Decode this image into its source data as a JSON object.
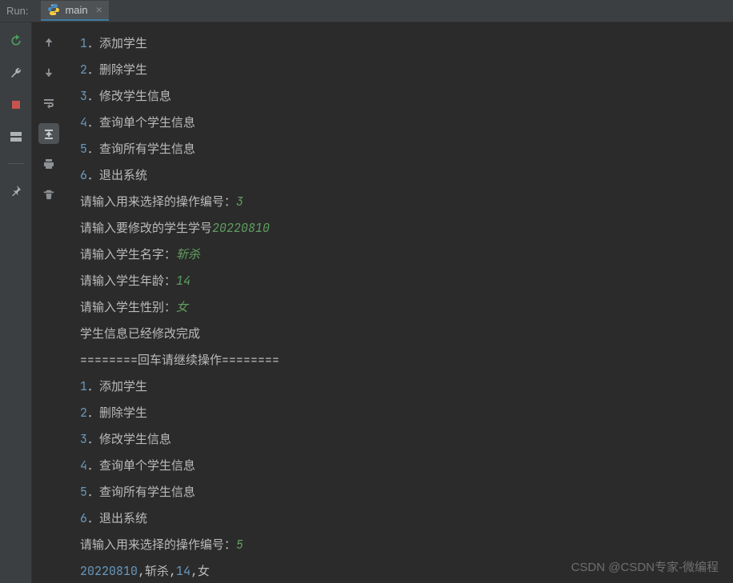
{
  "header": {
    "run_label": "Run:",
    "tab_name": "main",
    "close_char": "×"
  },
  "menu": {
    "m1": "添加学生",
    "m2": "删除学生",
    "m3": "修改学生信息",
    "m4": "查询单个学生信息",
    "m5": "查询所有学生信息",
    "m6": "退出系统"
  },
  "prompts": {
    "choose_op": "请输入用来选择的操作编号：",
    "choose_op_val1": "3",
    "enter_id": "请输入要修改的学生学号",
    "enter_id_val": "20220810",
    "enter_name": "请输入学生名字：",
    "enter_name_val": "斩杀",
    "enter_age": "请输入学生年龄：",
    "enter_age_val": "14",
    "enter_gender": "请输入学生性别：",
    "enter_gender_val": "女",
    "done": "学生信息已经修改完成",
    "continue": "========回车请继续操作========",
    "choose_op_val2": "5",
    "record": ",斩杀,",
    "record_id": "20220810",
    "record_age": "14",
    "record_gender": ",女"
  },
  "numbers": {
    "n1": "1",
    "n2": "2",
    "n3": "3",
    "n4": "4",
    "n5": "5",
    "n6": "6"
  },
  "watermark": "CSDN @CSDN专家-微编程"
}
